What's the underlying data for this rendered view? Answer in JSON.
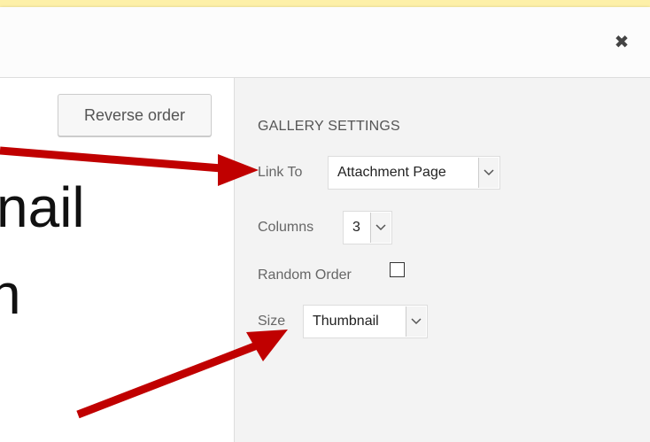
{
  "modal": {
    "close_glyph": "✖"
  },
  "left_panel": {
    "reverse_order_label": "Reverse order",
    "background_text_line1": "nail",
    "background_text_line2": "n"
  },
  "gallery_settings": {
    "title": "GALLERY SETTINGS",
    "link_to": {
      "label": "Link To",
      "value": "Attachment Page"
    },
    "columns": {
      "label": "Columns",
      "value": "3"
    },
    "random_order": {
      "label": "Random Order",
      "checked": false
    },
    "size": {
      "label": "Size",
      "value": "Thumbnail"
    }
  },
  "annotation_arrows": {
    "color": "#c00000"
  }
}
